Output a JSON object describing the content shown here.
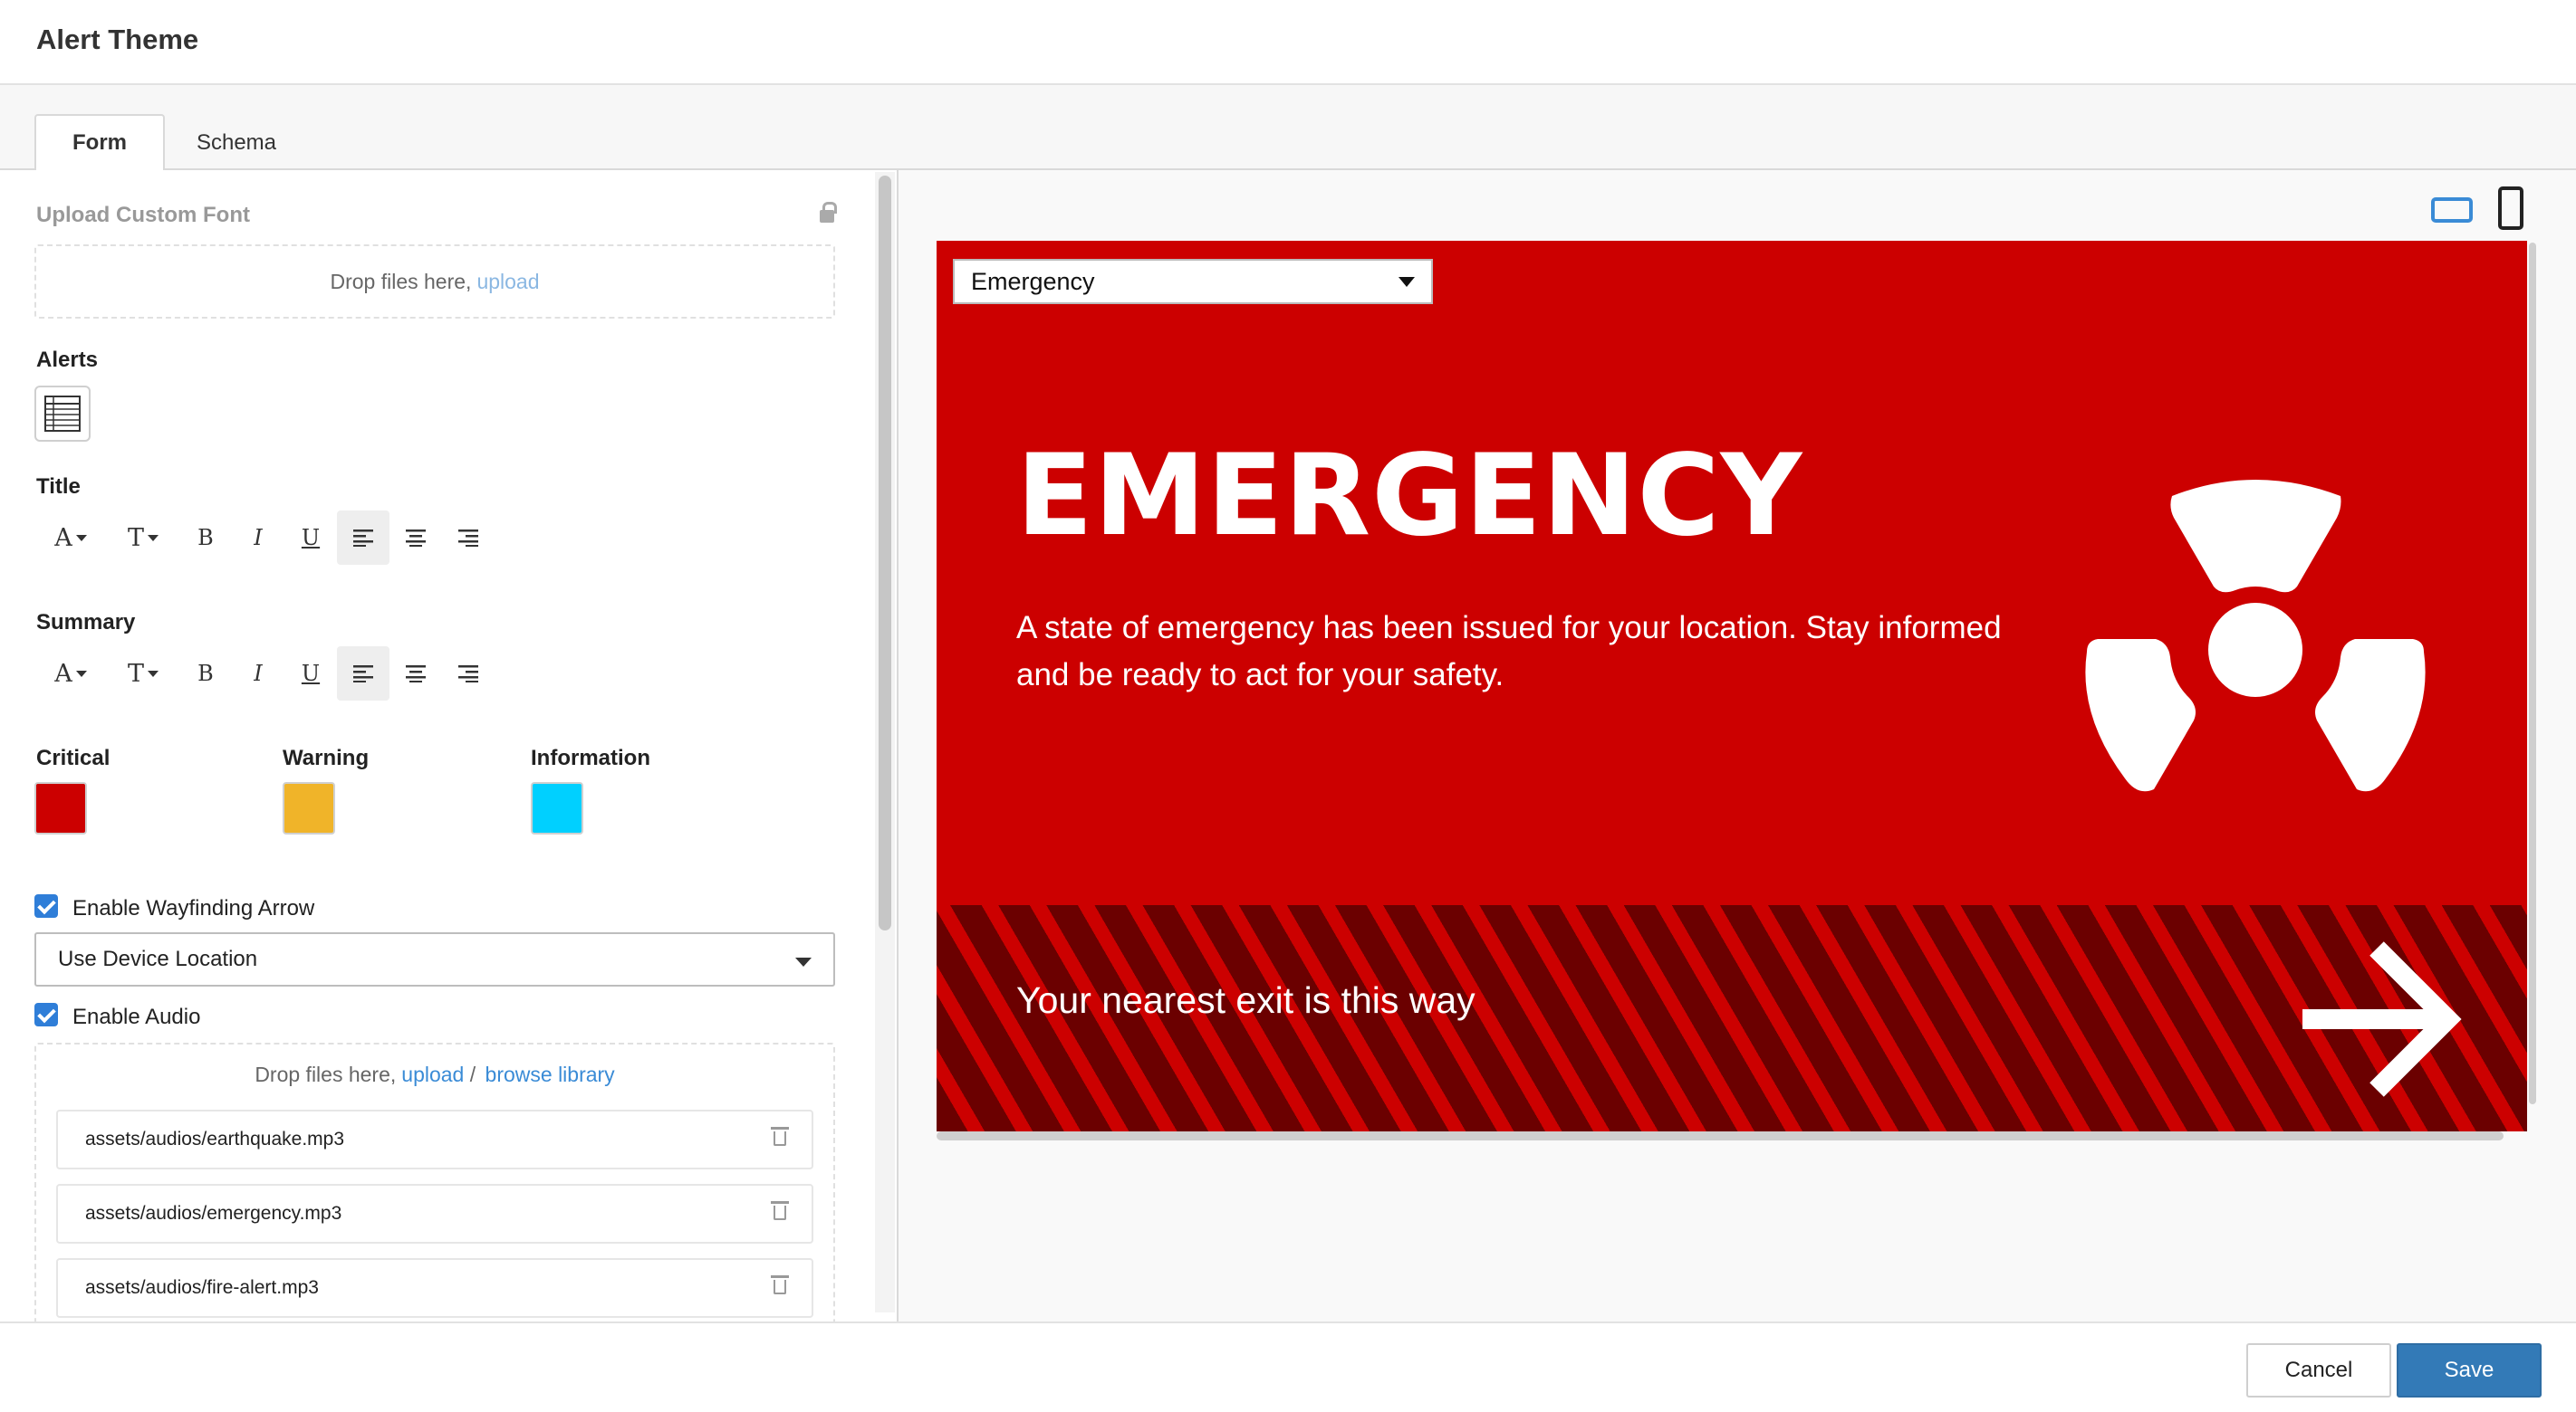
{
  "header": {
    "title": "Alert Theme"
  },
  "tabs": [
    {
      "label": "Form"
    },
    {
      "label": "Schema"
    }
  ],
  "form": {
    "custom_font": {
      "label": "Upload Custom Font",
      "drop_text": "Drop files here, ",
      "upload_link": "upload"
    },
    "alerts": {
      "label": "Alerts"
    },
    "title": {
      "label": "Title"
    },
    "summary": {
      "label": "Summary"
    },
    "toolbar_glyphs": {
      "font": "A",
      "size": "T",
      "bold": "B",
      "italic": "I",
      "underline": "U"
    },
    "colors": [
      {
        "label": "Critical",
        "value": "#cc0000"
      },
      {
        "label": "Warning",
        "value": "#f0b429"
      },
      {
        "label": "Information",
        "value": "#00d0ff"
      }
    ],
    "wayfinding": {
      "label": "Enable Wayfinding Arrow",
      "checked": true,
      "select_value": "Use Device Location"
    },
    "audio": {
      "label": "Enable Audio",
      "checked": true,
      "drop_text": "Drop files here, ",
      "upload_link": "upload",
      "separator": " / ",
      "browse_link": "browse library",
      "files": [
        "assets/audios/earthquake.mp3",
        "assets/audios/emergency.mp3",
        "assets/audios/fire-alert.mp3"
      ]
    }
  },
  "preview": {
    "select_value": "Emergency",
    "title": "EMERGENCY",
    "summary": "A state of emergency has been issued for your location. Stay informed and be ready to act for your safety.",
    "exit_text": "Your nearest exit is this way",
    "icon": "radiation-hazard-icon",
    "background": "#cc0000",
    "stripe_dark": "#6b0000"
  },
  "footer": {
    "cancel_label": "Cancel",
    "save_label": "Save"
  }
}
